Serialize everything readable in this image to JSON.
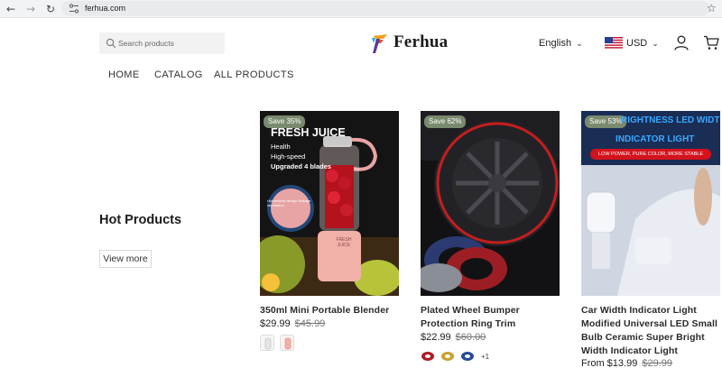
{
  "browser": {
    "url": "ferhua.com",
    "back_glyph": "←",
    "forward_glyph": "→",
    "reload_glyph": "↻",
    "star_glyph": "☆"
  },
  "header": {
    "search_placeholder": "Search products",
    "brand": "Ferhua",
    "language": "English",
    "currency": "USD"
  },
  "nav": [
    "HOME",
    "CATALOG",
    "ALL PRODUCTS"
  ],
  "hot": {
    "title": "Hot Products",
    "view_more": "View more"
  },
  "products": [
    {
      "badge": "Save 35%",
      "image_text": [
        "FRESH JUICE",
        "Health",
        "High-speed",
        "Upgraded 4 blades",
        "FRESH JUICE",
        "Humanized design leakage separation"
      ],
      "title": "350ml Mini Portable Blender",
      "price": "$29.99",
      "old_price": "$45.99",
      "swatches": 2
    },
    {
      "badge": "Save 62%",
      "title_lines": [
        "Plated Wheel Bumper",
        "Protection Ring Trim"
      ],
      "price": "$22.99",
      "old_price": "$60.00",
      "more": "+1"
    },
    {
      "badge": "Save 53%",
      "image_text": [
        "RIGHTNESS LED WIDTH",
        "INDICATOR LIGHT",
        "LOW POWER, PURE COLOR, MORE STABLE"
      ],
      "title_lines": [
        "Car Width Indicator Light",
        "Modified Universal LED Small",
        "Bulb Ceramic Super Bright",
        "Width Indicator Light"
      ],
      "price_prefix": "From",
      "price": "$13.99",
      "old_price": "$29.99"
    }
  ],
  "colors": {
    "badge": "#7a8a6e",
    "logo_orange": "#f0a020",
    "logo_purple": "#5b3a9a",
    "led_text": "#3aa8ff"
  }
}
